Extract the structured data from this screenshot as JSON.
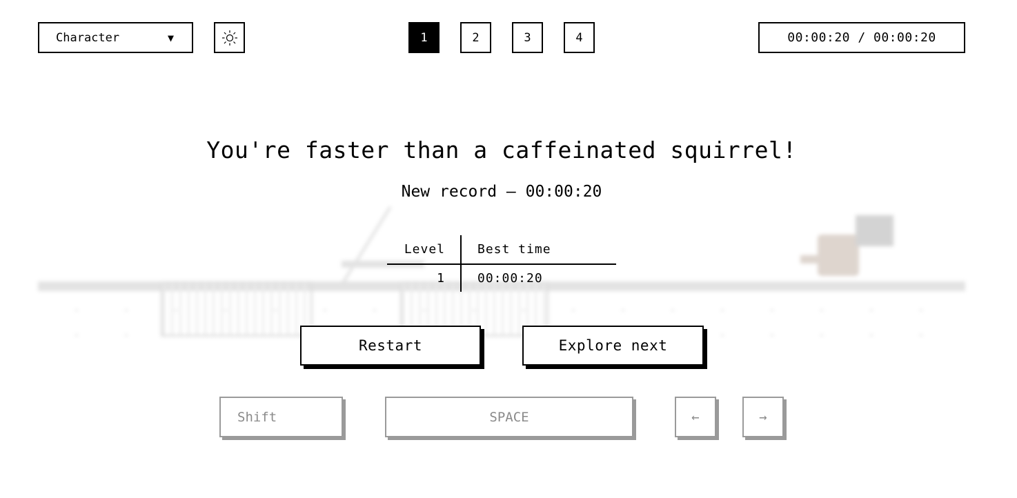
{
  "topbar": {
    "character_label": "Character",
    "character_arrow": "▼",
    "theme_icon": "sun-icon",
    "levels": [
      "1",
      "2",
      "3",
      "4"
    ],
    "active_level": "1",
    "timer": "00:00:20 / 00:00:20"
  },
  "result": {
    "title": "You're faster than a caffeinated squirrel!",
    "record": "New record – 00:00:20",
    "table": {
      "headers": [
        "Level",
        "Best time"
      ],
      "rows": [
        [
          "1",
          "00:00:20"
        ]
      ]
    },
    "restart_label": "Restart",
    "explore_label": "Explore next"
  },
  "keys": {
    "shift": "Shift",
    "space": "SPACE",
    "left": "←",
    "right": "→"
  }
}
